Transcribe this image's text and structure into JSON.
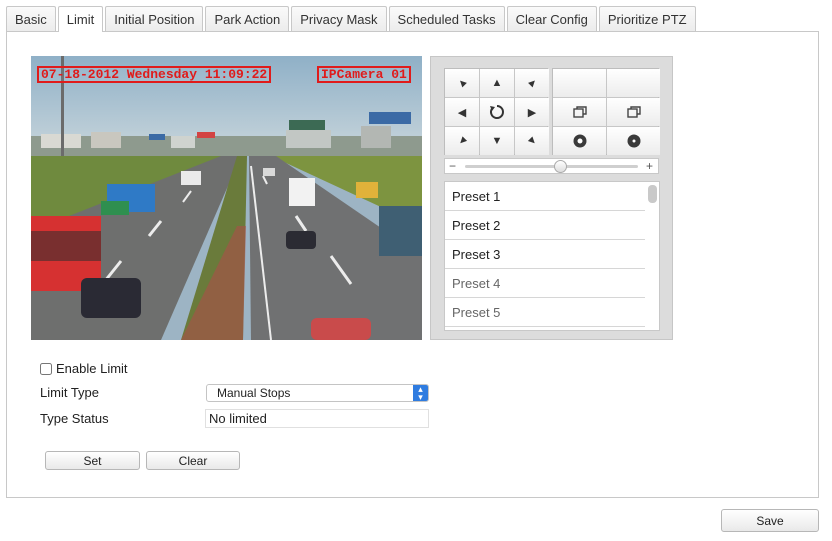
{
  "tabs": [
    {
      "label": "Basic"
    },
    {
      "label": "Limit",
      "active": true
    },
    {
      "label": "Initial Position"
    },
    {
      "label": "Park Action"
    },
    {
      "label": "Privacy Mask"
    },
    {
      "label": "Scheduled Tasks"
    },
    {
      "label": "Clear Config"
    },
    {
      "label": "Prioritize PTZ"
    }
  ],
  "video": {
    "osd_datetime": "07-18-2012 Wednesday 11:09:22",
    "osd_camera": "IPCamera 01"
  },
  "ptz": {
    "speed_minus": "−",
    "speed_plus": "+",
    "speed_level": 0.55,
    "presets": [
      {
        "label": "Preset 1"
      },
      {
        "label": "Preset 2"
      },
      {
        "label": "Preset 3"
      },
      {
        "label": "Preset 4"
      },
      {
        "label": "Preset 5"
      }
    ]
  },
  "form": {
    "enable_limit_label": "Enable Limit",
    "enable_limit_checked": false,
    "limit_type_label": "Limit Type",
    "limit_type_value": "Manual Stops",
    "type_status_label": "Type Status",
    "type_status_value": "No limited",
    "set_button": "Set",
    "clear_button": "Clear"
  },
  "footer": {
    "save_button": "Save"
  },
  "colors": {
    "osd_red": "#e01b1b",
    "select_accent": "#2f7ce0"
  }
}
